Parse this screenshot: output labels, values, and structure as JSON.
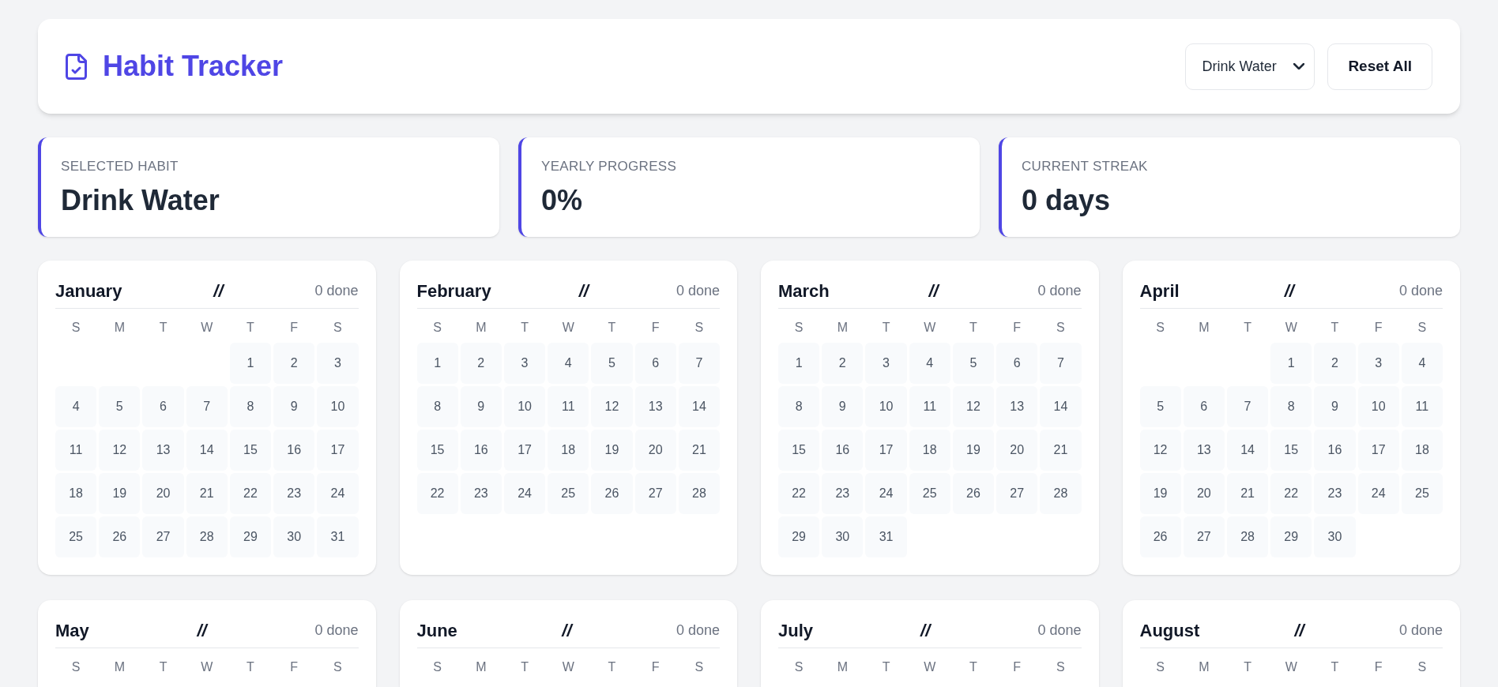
{
  "header": {
    "title": "Habit Tracker",
    "habit_select": {
      "value": "Drink Water"
    },
    "reset_button": "Reset All"
  },
  "stats": [
    {
      "label": "SELECTED HABIT",
      "value": "Drink Water"
    },
    {
      "label": "YEARLY PROGRESS",
      "value": "0%"
    },
    {
      "label": "CURRENT STREAK",
      "value": "0 days"
    }
  ],
  "months": [
    {
      "name": "January",
      "mark": "//",
      "done": "0 done",
      "weekdays": [
        "S",
        "M",
        "T",
        "W",
        "T",
        "F",
        "S"
      ],
      "weeks": [
        {
          "right_aligned": true,
          "days": [
            "1",
            "2",
            "3"
          ]
        },
        {
          "days": [
            "4",
            "5",
            "6",
            "7",
            "8",
            "9",
            "10"
          ]
        },
        {
          "days": [
            "11",
            "12",
            "13",
            "14",
            "15",
            "16",
            "17"
          ]
        },
        {
          "days": [
            "18",
            "19",
            "20",
            "21",
            "22",
            "23",
            "24"
          ]
        },
        {
          "days": [
            "25",
            "26",
            "27",
            "28",
            "29",
            "30",
            "31"
          ]
        }
      ]
    },
    {
      "name": "February",
      "mark": "//",
      "done": "0 done",
      "weekdays": [
        "S",
        "M",
        "T",
        "W",
        "T",
        "F",
        "S"
      ],
      "weeks": [
        {
          "days": [
            "1",
            "2",
            "3",
            "4",
            "5",
            "6",
            "7"
          ]
        },
        {
          "days": [
            "8",
            "9",
            "10",
            "11",
            "12",
            "13",
            "14"
          ]
        },
        {
          "days": [
            "15",
            "16",
            "17",
            "18",
            "19",
            "20",
            "21"
          ]
        },
        {
          "days": [
            "22",
            "23",
            "24",
            "25",
            "26",
            "27",
            "28"
          ]
        }
      ]
    },
    {
      "name": "March",
      "mark": "//",
      "done": "0 done",
      "weekdays": [
        "S",
        "M",
        "T",
        "W",
        "T",
        "F",
        "S"
      ],
      "weeks": [
        {
          "days": [
            "1",
            "2",
            "3",
            "4",
            "5",
            "6",
            "7"
          ]
        },
        {
          "days": [
            "8",
            "9",
            "10",
            "11",
            "12",
            "13",
            "14"
          ]
        },
        {
          "days": [
            "15",
            "16",
            "17",
            "18",
            "19",
            "20",
            "21"
          ]
        },
        {
          "days": [
            "22",
            "23",
            "24",
            "25",
            "26",
            "27",
            "28"
          ]
        },
        {
          "days": [
            "29",
            "30",
            "31"
          ]
        }
      ]
    },
    {
      "name": "April",
      "mark": "//",
      "done": "0 done",
      "weekdays": [
        "S",
        "M",
        "T",
        "W",
        "T",
        "F",
        "S"
      ],
      "weeks": [
        {
          "right_aligned": true,
          "days": [
            "1",
            "2",
            "3",
            "4"
          ]
        },
        {
          "days": [
            "5",
            "6",
            "7",
            "8",
            "9",
            "10",
            "11"
          ]
        },
        {
          "days": [
            "12",
            "13",
            "14",
            "15",
            "16",
            "17",
            "18"
          ]
        },
        {
          "days": [
            "19",
            "20",
            "21",
            "22",
            "23",
            "24",
            "25"
          ]
        },
        {
          "days": [
            "26",
            "27",
            "28",
            "29",
            "30"
          ]
        }
      ]
    },
    {
      "name": "May",
      "mark": "//",
      "done": "0 done",
      "weekdays": [
        "S",
        "M",
        "T",
        "W",
        "T",
        "F",
        "S"
      ]
    },
    {
      "name": "June",
      "mark": "//",
      "done": "0 done",
      "weekdays": [
        "S",
        "M",
        "T",
        "W",
        "T",
        "F",
        "S"
      ]
    },
    {
      "name": "July",
      "mark": "//",
      "done": "0 done",
      "weekdays": [
        "S",
        "M",
        "T",
        "W",
        "T",
        "F",
        "S"
      ]
    },
    {
      "name": "August",
      "mark": "//",
      "done": "0 done",
      "weekdays": [
        "S",
        "M",
        "T",
        "W",
        "T",
        "F",
        "S"
      ]
    }
  ]
}
